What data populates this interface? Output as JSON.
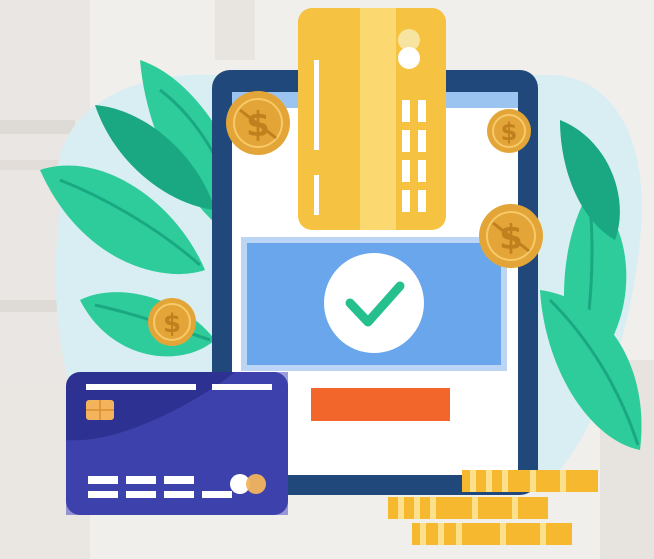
{
  "illustration": {
    "subject": "mobile-card-payment-success",
    "icons": {
      "coin": "dollar-coin-icon",
      "confirm": "checkmark-icon"
    },
    "colors": {
      "background": "#f1efec",
      "background_blob": "#d9eef2",
      "leaf": "#2ecc9a",
      "leaf_dark": "#1aa882",
      "tablet_frame": "#20487a",
      "tablet_screen": "#ffffff",
      "status_panel": "#6aa6ec",
      "status_panel_border": "#bcd5f4",
      "check_circle": "#ffffff",
      "check_mark": "#26c08f",
      "action_bar": "#f2662b",
      "gold_card": "#f5c242",
      "gold_card_stripe": "#fcd970",
      "coin": "#e3a537",
      "coin_symbol": "#c0801e",
      "navy_card": "#2c3192",
      "navy_card_accent": "#4a4fc0",
      "card_chip": "#f3b45d",
      "card_line": "#ffffff",
      "coin_stack": "#f5b82e",
      "coin_stack_edge": "#fde08a"
    }
  }
}
